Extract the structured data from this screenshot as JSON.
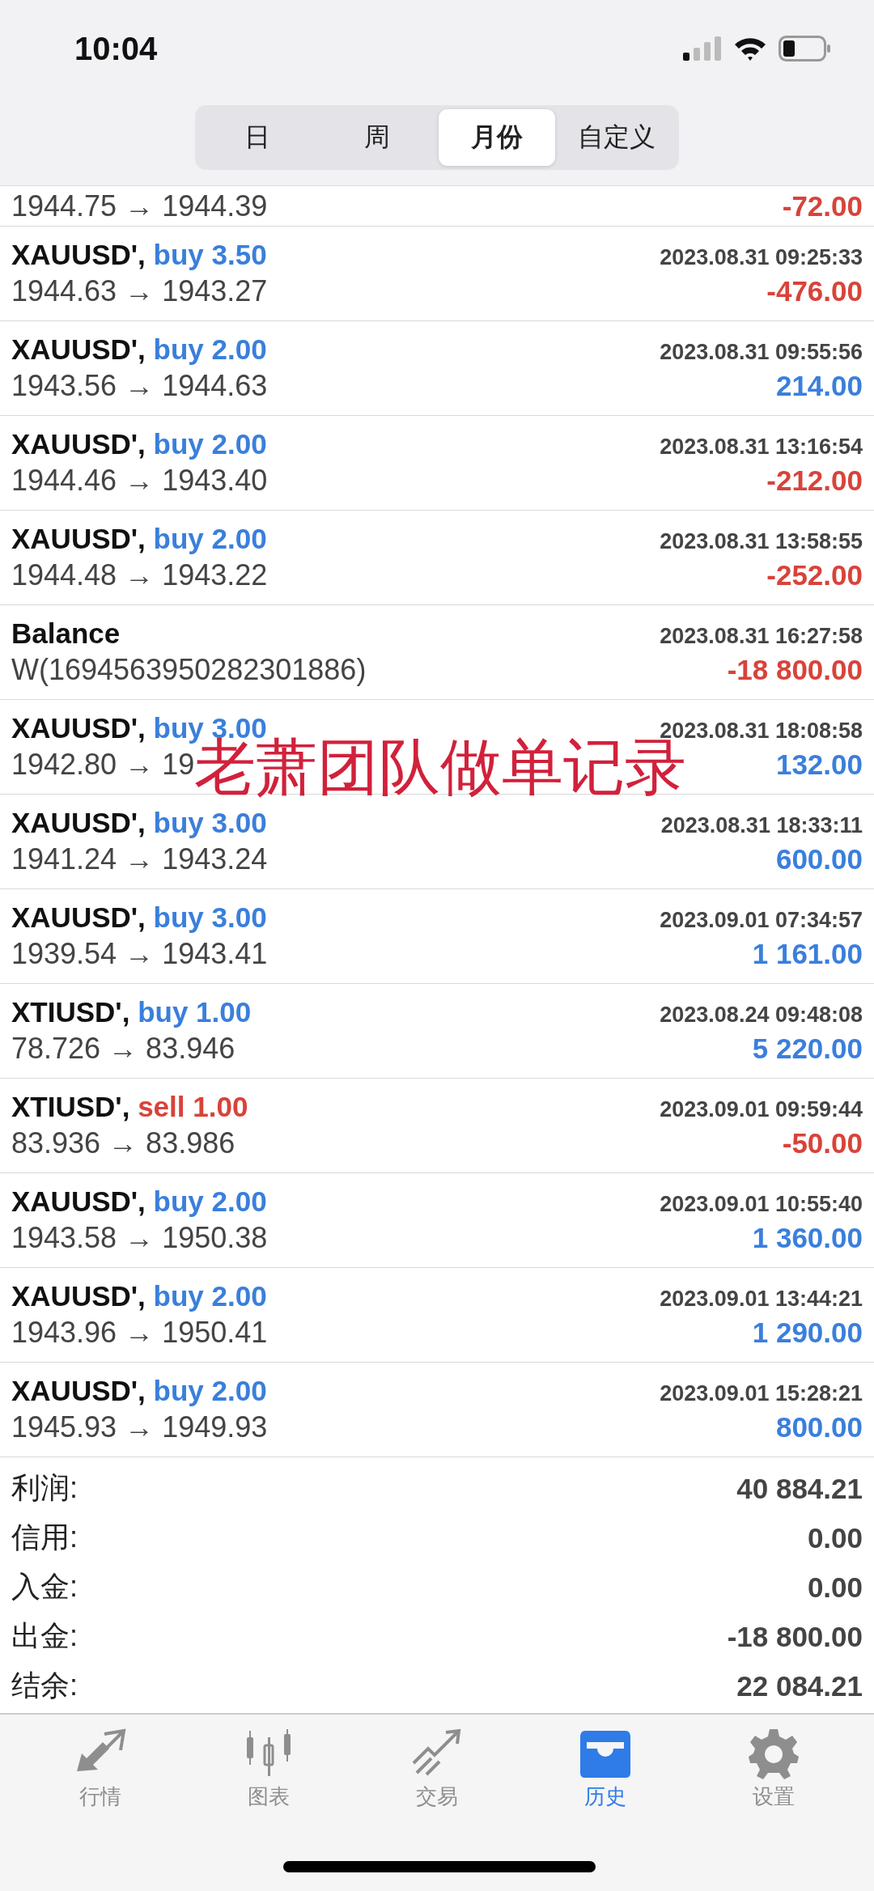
{
  "status_bar": {
    "time": "10:04"
  },
  "period_tabs": [
    {
      "label": "日",
      "selected": false
    },
    {
      "label": "周",
      "selected": false
    },
    {
      "label": "月份",
      "selected": true
    },
    {
      "label": "自定义",
      "selected": false
    }
  ],
  "partial_row": {
    "prices": "1944.75 → 1944.39",
    "profit": "-72.00",
    "color": "#d8433a"
  },
  "deals": [
    {
      "kind": "trade",
      "symbol": "XAUUSD',",
      "side": "buy",
      "volume": "3.50",
      "time": "2023.08.31 09:25:33",
      "prices": "1944.63 → 1943.27",
      "profit": "-476.00",
      "color": "#d8433a"
    },
    {
      "kind": "trade",
      "symbol": "XAUUSD',",
      "side": "buy",
      "volume": "2.00",
      "time": "2023.08.31 09:55:56",
      "prices": "1943.56 → 1944.63",
      "profit": "214.00",
      "color": "#3a7fdc"
    },
    {
      "kind": "trade",
      "symbol": "XAUUSD',",
      "side": "buy",
      "volume": "2.00",
      "time": "2023.08.31 13:16:54",
      "prices": "1944.46 → 1943.40",
      "profit": "-212.00",
      "color": "#d8433a"
    },
    {
      "kind": "trade",
      "symbol": "XAUUSD',",
      "side": "buy",
      "volume": "2.00",
      "time": "2023.08.31 13:58:55",
      "prices": "1944.48 → 1943.22",
      "profit": "-252.00",
      "color": "#d8433a"
    },
    {
      "kind": "balance",
      "symbol": "Balance",
      "time": "2023.08.31 16:27:58",
      "prices": "W(1694563950282301886)",
      "profit": "-18 800.00",
      "color": "#d8433a"
    },
    {
      "kind": "trade",
      "symbol": "XAUUSD',",
      "side": "buy",
      "volume": "3.00",
      "time": "2023.08.31 18:08:58",
      "prices": "1942.80 → 19",
      "profit": "132.00",
      "color": "#3a7fdc"
    },
    {
      "kind": "trade",
      "symbol": "XAUUSD',",
      "side": "buy",
      "volume": "3.00",
      "time": "2023.08.31 18:33:11",
      "prices": "1941.24 → 1943.24",
      "profit": "600.00",
      "color": "#3a7fdc"
    },
    {
      "kind": "trade",
      "symbol": "XAUUSD',",
      "side": "buy",
      "volume": "3.00",
      "time": "2023.09.01 07:34:57",
      "prices": "1939.54 → 1943.41",
      "profit": "1 161.00",
      "color": "#3a7fdc"
    },
    {
      "kind": "trade",
      "symbol": "XTIUSD',",
      "side": "buy",
      "volume": "1.00",
      "time": "2023.08.24 09:48:08",
      "prices": "78.726 → 83.946",
      "profit": "5 220.00",
      "color": "#3a7fdc"
    },
    {
      "kind": "trade",
      "symbol": "XTIUSD',",
      "side": "sell",
      "volume": "1.00",
      "time": "2023.09.01 09:59:44",
      "prices": "83.936 → 83.986",
      "profit": "-50.00",
      "color": "#d8433a"
    },
    {
      "kind": "trade",
      "symbol": "XAUUSD',",
      "side": "buy",
      "volume": "2.00",
      "time": "2023.09.01 10:55:40",
      "prices": "1943.58 → 1950.38",
      "profit": "1 360.00",
      "color": "#3a7fdc"
    },
    {
      "kind": "trade",
      "symbol": "XAUUSD',",
      "side": "buy",
      "volume": "2.00",
      "time": "2023.09.01 13:44:21",
      "prices": "1943.96 → 1950.41",
      "profit": "1 290.00",
      "color": "#3a7fdc"
    },
    {
      "kind": "trade",
      "symbol": "XAUUSD',",
      "side": "buy",
      "volume": "2.00",
      "time": "2023.09.01 15:28:21",
      "prices": "1945.93 → 1949.93",
      "profit": "800.00",
      "color": "#3a7fdc"
    }
  ],
  "overlay_text": "老萧团队做单记录",
  "summary": [
    {
      "label": "利润:",
      "value": "40 884.21"
    },
    {
      "label": "信用:",
      "value": "0.00"
    },
    {
      "label": "入金:",
      "value": "0.00"
    },
    {
      "label": "出金:",
      "value": "-18 800.00"
    },
    {
      "label": "结余:",
      "value": "22 084.21"
    }
  ],
  "bottom_nav": [
    {
      "kind": "quotes",
      "label": "行情",
      "selected": false
    },
    {
      "kind": "chart",
      "label": "图表",
      "selected": false
    },
    {
      "kind": "trade",
      "label": "交易",
      "selected": false
    },
    {
      "kind": "history",
      "label": "历史",
      "selected": true
    },
    {
      "kind": "settings",
      "label": "设置",
      "selected": false
    }
  ]
}
